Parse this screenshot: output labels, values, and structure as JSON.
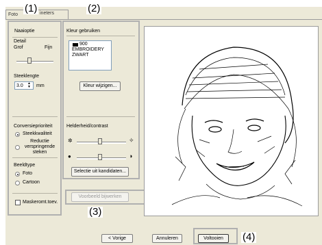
{
  "tab": {
    "label_left": "Foto",
    "label_right": "ineters"
  },
  "callouts": [
    "(1)",
    "(2)",
    "(3)",
    "(4)"
  ],
  "left_panel": {
    "stitch_option_title": "Naaioptie",
    "detail_label": "Detail",
    "detail_min": "Grof",
    "detail_max": "Fijn",
    "stitch_length_label": "Steeklengte",
    "stitch_length_value": "3.0",
    "stitch_length_unit": "mm",
    "conversion_priority_label": "Conversieprioriteit",
    "priority_options": [
      "Steekkwaliteit",
      "Reductie verspringende steken"
    ],
    "priority_selected": 0,
    "image_type_label": "Beeldtype",
    "image_type_options": [
      "Foto",
      "Cartoon"
    ],
    "image_type_selected": 0,
    "mask_checkbox_label": "Maskeromt.toev."
  },
  "middle_panel": {
    "use_color_label": "Kleur gebruiken",
    "color_list": [
      {
        "code": "900",
        "swatch": "#000000"
      },
      {
        "code": "EMBROIDERY",
        "swatch": ""
      },
      {
        "code": "ZWART",
        "swatch": ""
      }
    ],
    "change_color_button": "Kleur wijzigen...",
    "brightness_contrast_label": "Helderheid/contrast",
    "select_candidates_button": "Selectie uit kandidaten..."
  },
  "update_preview_button": "Voorbeeld bijwerken",
  "footer": {
    "back_button": "< Vorige",
    "cancel_button": "Annuleren",
    "finish_button": "Voltooien"
  },
  "colors": {
    "dialog_bg": "#ece9d8",
    "highlight_frame": "#b0b0b0",
    "list_border": "#7f9db9"
  }
}
